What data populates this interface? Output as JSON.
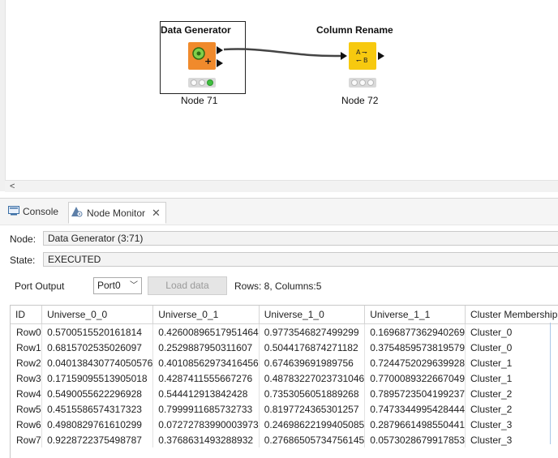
{
  "workflow": {
    "nodes": [
      {
        "title": "Data Generator",
        "label": "Node 71"
      },
      {
        "title": "Column Rename",
        "label": "Node 72"
      }
    ],
    "column_rename_icon_text": "A→\n←B",
    "hscroll_arrow": "<"
  },
  "tabs": {
    "console": "Console",
    "node_monitor": "Node Monitor"
  },
  "monitor": {
    "node_label": "Node:",
    "node_value": "Data Generator  (3:71)",
    "state_label": "State:",
    "state_value": "EXECUTED",
    "port_output_label": "Port Output",
    "port_select_value": "Port 0",
    "load_button": "Load data",
    "summary": "Rows: 8, Columns: 5"
  },
  "table": {
    "columns": [
      "ID",
      "Universe_0_0",
      "Universe_0_1",
      "Universe_1_0",
      "Universe_1_1",
      "Cluster Membership"
    ],
    "rows": [
      [
        "Row0",
        "0.5700515520161814",
        "0.4260089651795146 4",
        "0.9773546827499299",
        "0.1696877362940269",
        "Cluster_0"
      ],
      [
        "Row1",
        "0.6815702535026097",
        "0.2529887950311607",
        "0.5044176874271182",
        "0.3754859573819579",
        "Cluster_0"
      ],
      [
        "Row2",
        "0.040138430774050576",
        "0.40108562973416456",
        "0.674639691989756",
        "0.7244752029639928",
        "Cluster_1"
      ],
      [
        "Row3",
        "0.17159095513905018",
        "0.4287411555667276",
        "0.48783227023731046",
        "0.7700089322667049",
        "Cluster_1"
      ],
      [
        "Row4",
        "0.5490055622296928",
        "0.544412913842428",
        "0.7353056051889268",
        "0.7895723504199237",
        "Cluster_2"
      ],
      [
        "Row5",
        "0.4515586574317323",
        "0.7999911685732733",
        "0.8197724365301257",
        "0.7473344995428444",
        "Cluster_2"
      ],
      [
        "Row6",
        "0.4980829761610299",
        "0.07272783990003973",
        "0.24698622199405085",
        "0.2879661498550441",
        "Cluster_3"
      ],
      [
        "Row7",
        "0.9228722375498787",
        "0.3768631493288932",
        "0.27686505734756145",
        "0.0573028679917853",
        "Cluster_3"
      ]
    ]
  },
  "colors": {
    "data_generator_node": "#f08a2c",
    "column_rename_node": "#f7c90f",
    "status_green": "#3fbf3f"
  }
}
